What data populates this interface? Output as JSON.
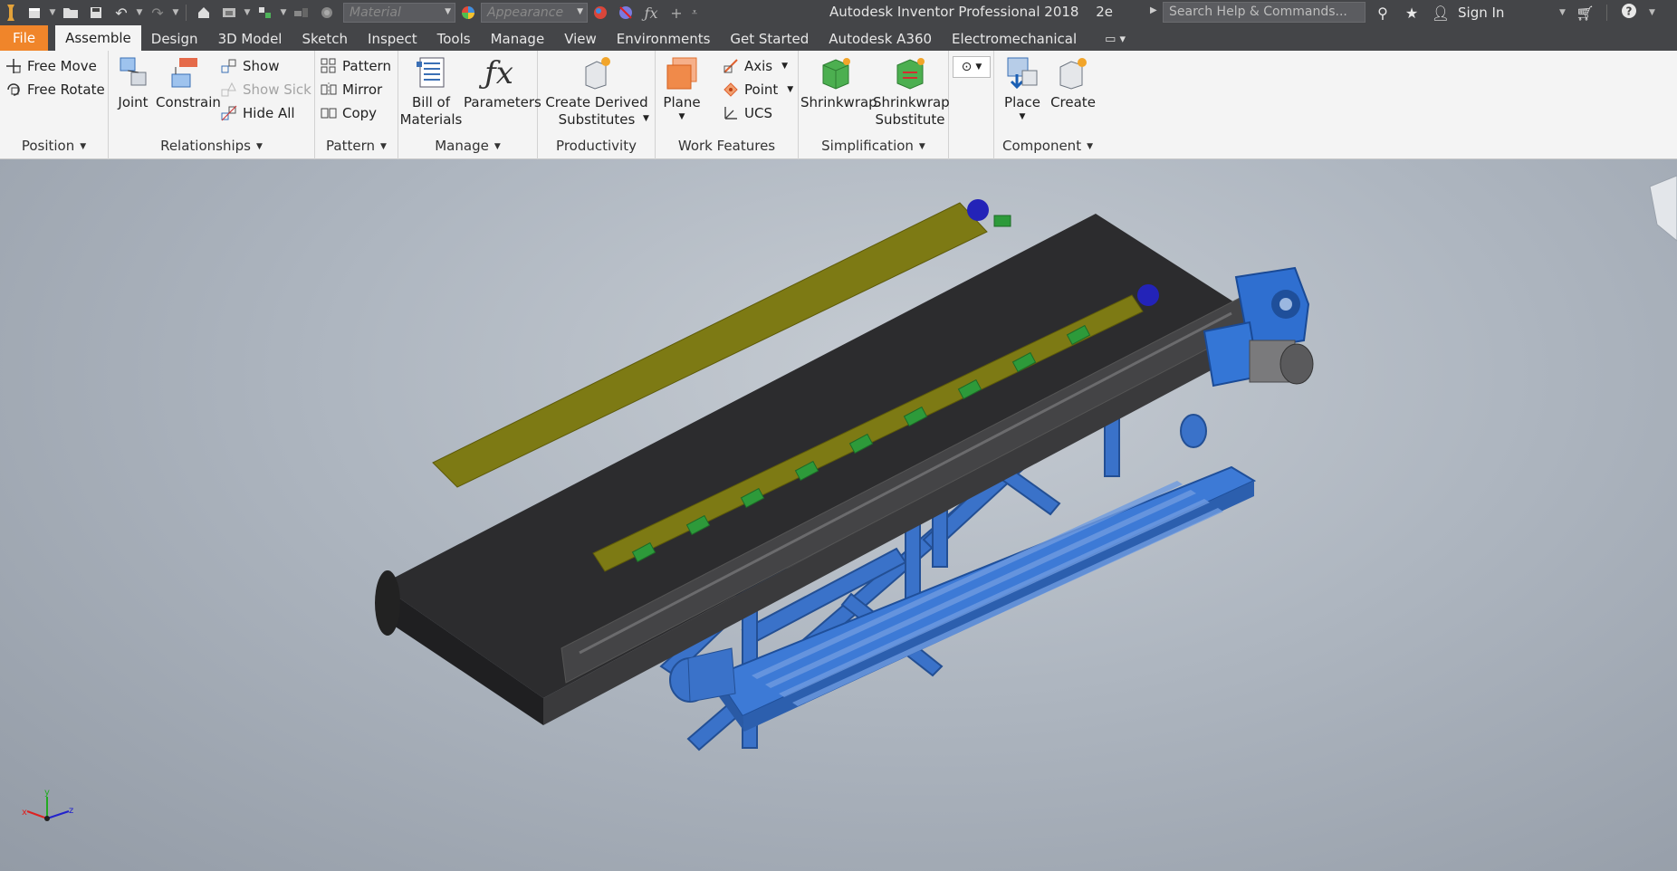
{
  "app": {
    "title": "Autodesk Inventor Professional 2018",
    "doc_suffix": "2e",
    "search_placeholder": "Search Help & Commands...",
    "sign_in": "Sign In"
  },
  "quick_access": {
    "material_placeholder": "Material",
    "appearance_placeholder": "Appearance"
  },
  "tabs": [
    {
      "label": "File"
    },
    {
      "label": "Assemble"
    },
    {
      "label": "Design"
    },
    {
      "label": "3D Model"
    },
    {
      "label": "Sketch"
    },
    {
      "label": "Inspect"
    },
    {
      "label": "Tools"
    },
    {
      "label": "Manage"
    },
    {
      "label": "View"
    },
    {
      "label": "Environments"
    },
    {
      "label": "Get Started"
    },
    {
      "label": "Autodesk A360"
    },
    {
      "label": "Electromechanical"
    }
  ],
  "ribbon": {
    "position": {
      "title": "Position",
      "free_move": "Free Move",
      "free_rotate": "Free Rotate"
    },
    "relationships": {
      "title": "Relationships",
      "joint": "Joint",
      "constrain": "Constrain",
      "show": "Show",
      "show_sick": "Show Sick",
      "hide_all": "Hide All"
    },
    "pattern": {
      "title": "Pattern",
      "pattern": "Pattern",
      "mirror": "Mirror",
      "copy": "Copy"
    },
    "manage": {
      "title": "Manage",
      "bom_line1": "Bill of",
      "bom_line2": "Materials",
      "parameters": "Parameters"
    },
    "productivity": {
      "title": "Productivity",
      "line1": "Create Derived",
      "line2": "Substitutes"
    },
    "work_features": {
      "title": "Work Features",
      "plane": "Plane",
      "axis": "Axis",
      "point": "Point",
      "ucs": "UCS"
    },
    "simplification": {
      "title": "Simplification",
      "shrinkwrap": "Shrinkwrap",
      "substitute_line1": "Shrinkwrap",
      "substitute_line2": "Substitute"
    },
    "component": {
      "title": "Component",
      "place": "Place",
      "create": "Create"
    }
  },
  "colors": {
    "titlebar": "#444548",
    "file_tab": "#f0852a",
    "ribbon": "#f4f4f4",
    "belt": "#2e2e30",
    "guard": "#7d7a14",
    "frame": "#3a73c8",
    "motor": "#2f6fd0"
  }
}
